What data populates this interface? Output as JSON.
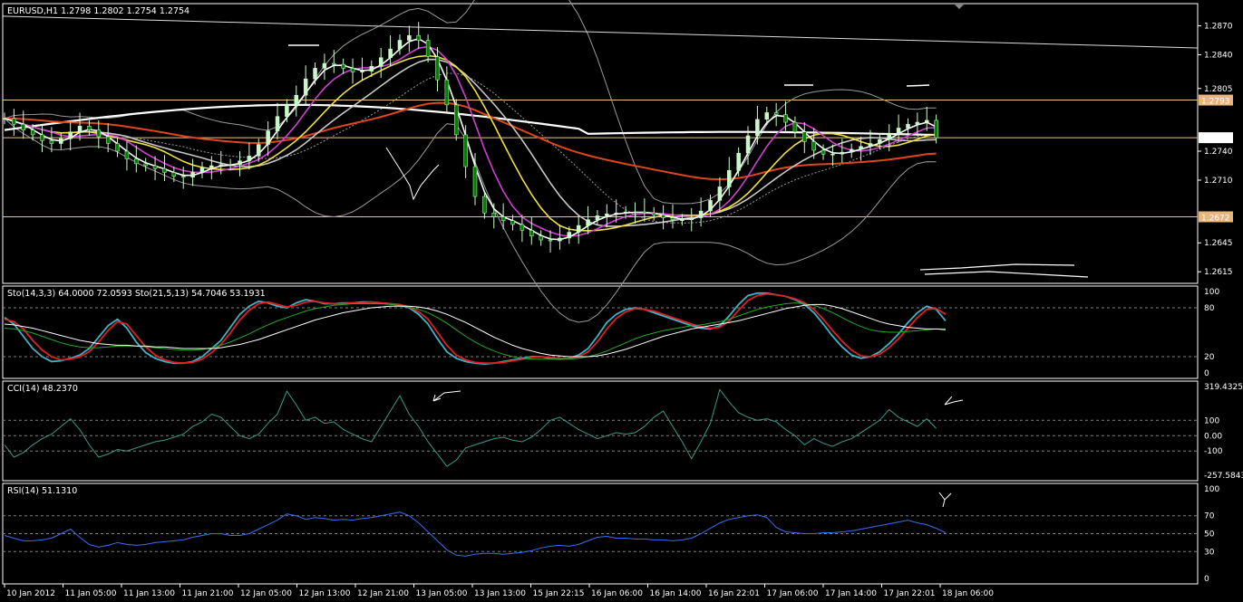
{
  "colors": {
    "background": "#000000",
    "frame": "#ffffff",
    "grid": "#808080",
    "bull_candle": "#c8f7c8",
    "bear_candle": "#008000",
    "hline": "#e8c58a",
    "price_tag_light": "#ffffff",
    "price_tag_orange": "#e8b57a"
  },
  "chart_data": [
    {
      "type": "candlestick",
      "panel": "main",
      "title": "EURUSD,H1  1.2798 1.2802 1.2754 1.2754",
      "y_ticks": [
        "1.2870",
        "1.2840",
        "1.2805",
        "1.2740",
        "1.2710",
        "1.2645",
        "1.2615"
      ],
      "ylim": [
        1.2603,
        1.2893
      ],
      "price_tags": [
        {
          "value": "1.2793",
          "style": "orange"
        },
        {
          "value": "1.2754",
          "style": "light"
        },
        {
          "value": "1.2672",
          "style": "orange"
        }
      ],
      "horizontal_lines": [
        1.2793,
        1.2754,
        1.2672
      ],
      "close": [
        1.2774,
        1.2768,
        1.2762,
        1.2757,
        1.2751,
        1.2748,
        1.2753,
        1.276,
        1.2766,
        1.2762,
        1.2755,
        1.2748,
        1.274,
        1.2732,
        1.2727,
        1.2725,
        1.2722,
        1.2718,
        1.2714,
        1.2713,
        1.2718,
        1.2723,
        1.2725,
        1.2726,
        1.2726,
        1.273,
        1.2735,
        1.2747,
        1.2761,
        1.2776,
        1.2788,
        1.2798,
        1.2815,
        1.2826,
        1.2831,
        1.283,
        1.2826,
        1.2822,
        1.2823,
        1.2828,
        1.2837,
        1.2846,
        1.2855,
        1.286,
        1.2855,
        1.2838,
        1.2814,
        1.2788,
        1.2757,
        1.2724,
        1.2693,
        1.2676,
        1.2672,
        1.2668,
        1.2664,
        1.2658,
        1.2652,
        1.2648,
        1.2647,
        1.265,
        1.2656,
        1.2663,
        1.2669,
        1.2673,
        1.2675,
        1.2676,
        1.2677,
        1.2677,
        1.2676,
        1.2674,
        1.2671,
        1.2669,
        1.2669,
        1.2671,
        1.2678,
        1.2689,
        1.2703,
        1.272,
        1.2738,
        1.2756,
        1.2773,
        1.278,
        1.2778,
        1.277,
        1.276,
        1.275,
        1.2741,
        1.2737,
        1.2737,
        1.2739,
        1.2742,
        1.2745,
        1.2748,
        1.2752,
        1.2758,
        1.2764,
        1.2768,
        1.277,
        1.2772,
        1.2754
      ],
      "indicators": [
        "SMA 200 (white thick)",
        "EMA 50 (orange-red)",
        "MA 21 (yellow)",
        "MA 14 (grey)",
        "MA 8 (magenta)",
        "MA 5 (white)",
        "Bollinger Bands (grey)",
        "Trendline (white)"
      ]
    },
    {
      "type": "line",
      "panel": "stochastic",
      "label": "Sto(14,3,3) 64.0000 72.0593  Sto(21,5,13) 54.7046 53.1931",
      "y_ticks": [
        "100",
        "80",
        "20",
        "0"
      ],
      "ylim": [
        0,
        100
      ],
      "levels": [
        80,
        20
      ],
      "series": [
        {
          "name": "Sto(14,3,3) main",
          "color": "#3fb3c9",
          "values": [
            68,
            60,
            45,
            30,
            20,
            14,
            15,
            18,
            22,
            30,
            44,
            58,
            66,
            55,
            38,
            25,
            18,
            14,
            12,
            12,
            14,
            20,
            30,
            40,
            56,
            72,
            82,
            88,
            86,
            82,
            80,
            86,
            90,
            88,
            85,
            85,
            86,
            86,
            87,
            87,
            86,
            85,
            83,
            80,
            72,
            60,
            42,
            26,
            18,
            14,
            12,
            11,
            12,
            14,
            16,
            18,
            20,
            20,
            18,
            17,
            18,
            22,
            30,
            45,
            62,
            72,
            78,
            80,
            78,
            74,
            70,
            66,
            62,
            58,
            55,
            54,
            58,
            70,
            84,
            95,
            98,
            98,
            96,
            94,
            90,
            84,
            74,
            60,
            45,
            32,
            22,
            18,
            20,
            26,
            36,
            48,
            62,
            74,
            82,
            78,
            64
          ]
        },
        {
          "name": "Sto(14,3,3) signal",
          "color": "#e02020",
          "values": [
            66,
            63,
            54,
            40,
            28,
            20,
            16,
            17,
            20,
            26,
            38,
            52,
            63,
            60,
            46,
            32,
            22,
            16,
            13,
            12,
            13,
            17,
            25,
            35,
            49,
            65,
            77,
            85,
            87,
            84,
            81,
            83,
            87,
            88,
            86,
            85,
            85,
            86,
            86,
            87,
            86,
            85,
            84,
            81,
            75,
            66,
            50,
            34,
            22,
            16,
            13,
            12,
            12,
            13,
            15,
            17,
            19,
            20,
            19,
            18,
            18,
            20,
            26,
            38,
            54,
            67,
            75,
            79,
            78,
            76,
            72,
            68,
            64,
            60,
            57,
            55,
            56,
            64,
            77,
            89,
            95,
            97,
            96,
            94,
            91,
            86,
            78,
            66,
            52,
            39,
            28,
            21,
            20,
            23,
            31,
            42,
            55,
            68,
            78,
            79,
            72
          ]
        },
        {
          "name": "Sto(21,5,13) main",
          "color": "#22aa22",
          "values": [
            55,
            54,
            52,
            49,
            45,
            41,
            37,
            34,
            32,
            31,
            31,
            32,
            33,
            33,
            33,
            32,
            31,
            30,
            29,
            28,
            28,
            29,
            31,
            34,
            38,
            43,
            48,
            54,
            59,
            64,
            68,
            72,
            76,
            79,
            81,
            83,
            84,
            85,
            85,
            85,
            85,
            84,
            83,
            81,
            78,
            74,
            68,
            61,
            53,
            45,
            38,
            32,
            27,
            23,
            20,
            18,
            17,
            17,
            17,
            17,
            17,
            18,
            20,
            23,
            27,
            32,
            37,
            42,
            46,
            49,
            52,
            54,
            56,
            58,
            59,
            61,
            63,
            66,
            70,
            74,
            78,
            81,
            83,
            85,
            86,
            85,
            83,
            79,
            74,
            68,
            62,
            57,
            53,
            51,
            50,
            50,
            51,
            52,
            53,
            54,
            54
          ]
        },
        {
          "name": "Sto(21,5,13) signal",
          "color": "#ffffff",
          "values": [
            60,
            59,
            57,
            55,
            52,
            49,
            46,
            43,
            40,
            38,
            36,
            35,
            34,
            34,
            33,
            33,
            32,
            32,
            31,
            30,
            30,
            30,
            30,
            31,
            33,
            35,
            38,
            41,
            45,
            49,
            53,
            57,
            61,
            65,
            68,
            71,
            74,
            76,
            78,
            80,
            81,
            82,
            82,
            82,
            81,
            79,
            76,
            72,
            67,
            62,
            56,
            50,
            44,
            39,
            34,
            30,
            27,
            24,
            22,
            21,
            20,
            20,
            20,
            21,
            23,
            26,
            29,
            33,
            37,
            41,
            45,
            48,
            51,
            54,
            56,
            58,
            60,
            62,
            64,
            67,
            70,
            73,
            76,
            79,
            81,
            83,
            84,
            84,
            82,
            79,
            75,
            71,
            67,
            63,
            60,
            58,
            56,
            55,
            54,
            54,
            53
          ]
        }
      ]
    },
    {
      "type": "line",
      "panel": "cci",
      "label": "CCI(14) 48.2370",
      "y_ticks": [
        "319.4325",
        "100",
        "0.00",
        "-100",
        "-257.5843"
      ],
      "ylim": [
        -257.5843,
        319.4325
      ],
      "levels": [
        100,
        0,
        -100
      ],
      "series": [
        {
          "name": "CCI(14)",
          "color": "#3a9a8a",
          "values": [
            -60,
            -140,
            -110,
            -60,
            -20,
            10,
            60,
            110,
            40,
            -60,
            -140,
            -120,
            -90,
            -100,
            -80,
            -60,
            -40,
            -30,
            -10,
            10,
            60,
            90,
            140,
            120,
            60,
            0,
            -20,
            10,
            80,
            140,
            290,
            200,
            100,
            120,
            80,
            90,
            40,
            10,
            -20,
            -40,
            60,
            160,
            260,
            140,
            60,
            -40,
            -120,
            -200,
            -160,
            -80,
            -60,
            -40,
            -20,
            -10,
            -30,
            -40,
            -10,
            40,
            100,
            120,
            80,
            40,
            10,
            -20,
            0,
            20,
            10,
            20,
            60,
            120,
            160,
            60,
            -40,
            -150,
            -40,
            80,
            300,
            220,
            150,
            120,
            100,
            110,
            90,
            40,
            0,
            -60,
            -20,
            -50,
            -70,
            -40,
            -20,
            20,
            60,
            100,
            170,
            120,
            90,
            60,
            110,
            48
          ]
        }
      ]
    },
    {
      "type": "line",
      "panel": "rsi",
      "label": "RSI(14) 51.1310",
      "y_ticks": [
        "100",
        "70",
        "50",
        "30",
        "0"
      ],
      "ylim": [
        0,
        100
      ],
      "levels": [
        70,
        50,
        30
      ],
      "series": [
        {
          "name": "RSI(14)",
          "color": "#3a6ef0",
          "values": [
            48,
            45,
            42,
            42,
            43,
            45,
            50,
            55,
            46,
            38,
            35,
            37,
            40,
            38,
            37,
            38,
            40,
            41,
            42,
            43,
            46,
            48,
            50,
            50,
            48,
            48,
            50,
            55,
            60,
            65,
            72,
            70,
            66,
            68,
            67,
            65,
            66,
            65,
            67,
            68,
            70,
            72,
            74,
            70,
            62,
            52,
            42,
            32,
            26,
            25,
            27,
            28,
            28,
            27,
            28,
            29,
            31,
            34,
            36,
            37,
            36,
            38,
            42,
            46,
            47,
            45,
            45,
            44,
            44,
            43,
            43,
            42,
            43,
            45,
            50,
            56,
            62,
            66,
            68,
            70,
            71,
            68,
            57,
            52,
            51,
            50,
            50,
            51,
            51,
            52,
            53,
            55,
            57,
            59,
            61,
            63,
            65,
            62,
            60,
            56,
            51
          ]
        }
      ]
    }
  ],
  "x_axis": {
    "labels": [
      "10 Jan 2012",
      "11 Jan 05:00",
      "11 Jan 13:00",
      "11 Jan 21:00",
      "12 Jan 05:00",
      "12 Jan 13:00",
      "12 Jan 21:00",
      "13 Jan 05:00",
      "13 Jan 13:00",
      "15 Jan 22:15",
      "16 Jan 06:00",
      "16 Jan 14:00",
      "16 Jan 22:01",
      "17 Jan 06:00",
      "17 Jan 14:00",
      "17 Jan 22:01",
      "18 Jan 06:00"
    ]
  }
}
